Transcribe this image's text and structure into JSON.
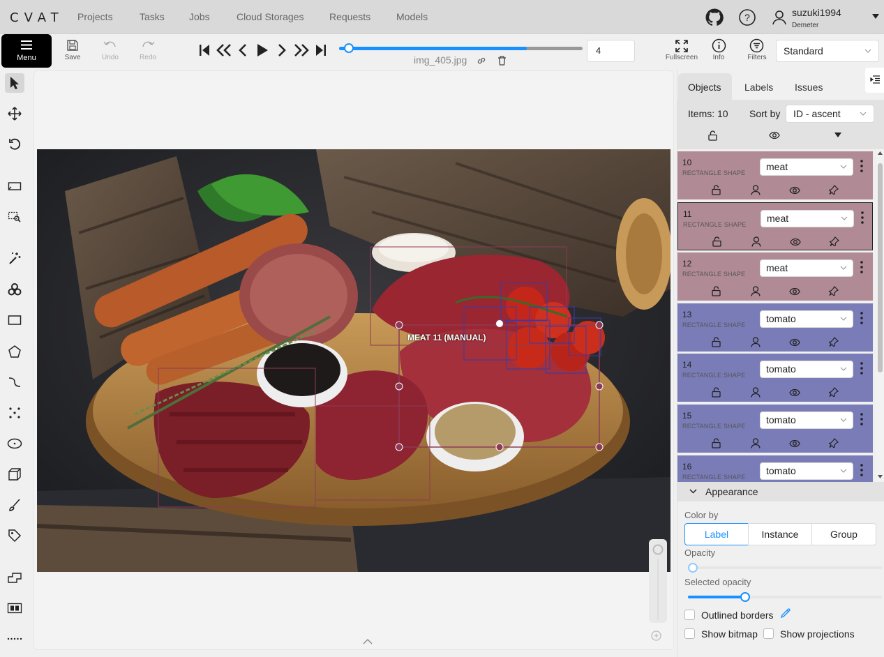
{
  "app": {
    "logo": "CVAT"
  },
  "nav": {
    "items": [
      "Projects",
      "Tasks",
      "Jobs",
      "Cloud Storages",
      "Requests",
      "Models"
    ]
  },
  "user": {
    "name": "suzuki1994",
    "org": "Demeter"
  },
  "toolbar": {
    "menu_label": "Menu",
    "save_label": "Save",
    "undo_label": "Undo",
    "redo_label": "Redo",
    "frame_number": "4",
    "filename": "img_405.jpg",
    "fullscreen_label": "Fullscreen",
    "info_label": "Info",
    "filters_label": "Filters",
    "workspace": "Standard",
    "progress": 0.77
  },
  "canvas": {
    "selected_label": "MEAT 11 (MANUAL)"
  },
  "sidebar": {
    "tabs": [
      "Objects",
      "Labels",
      "Issues"
    ],
    "items_count": "Items: 10",
    "sort_label": "Sort by",
    "sort_value": "ID - ascent",
    "objects": [
      {
        "id": "10",
        "kind": "RECTANGLE SHAPE",
        "label": "meat",
        "color": "#b08a94"
      },
      {
        "id": "11",
        "kind": "RECTANGLE SHAPE",
        "label": "meat",
        "color": "#b08a94"
      },
      {
        "id": "12",
        "kind": "RECTANGLE SHAPE",
        "label": "meat",
        "color": "#b08a94"
      },
      {
        "id": "13",
        "kind": "RECTANGLE SHAPE",
        "label": "tomato",
        "color": "#7a7cb8"
      },
      {
        "id": "14",
        "kind": "RECTANGLE SHAPE",
        "label": "tomato",
        "color": "#7a7cb8"
      },
      {
        "id": "15",
        "kind": "RECTANGLE SHAPE",
        "label": "tomato",
        "color": "#7a7cb8"
      },
      {
        "id": "16",
        "kind": "RECTANGLE SHAPE",
        "label": "tomato",
        "color": "#7a7cb8"
      }
    ]
  },
  "appearance": {
    "title": "Appearance",
    "color_by": "Color by",
    "color_options": [
      "Label",
      "Instance",
      "Group"
    ],
    "opacity": "Opacity",
    "selected_opacity": "Selected opacity",
    "outlined_borders": "Outlined borders",
    "show_bitmap": "Show bitmap",
    "show_projections": "Show projections"
  },
  "colors": {
    "accent": "#1890ff",
    "meat": "#b08a94",
    "tomato": "#7a7cb8"
  }
}
